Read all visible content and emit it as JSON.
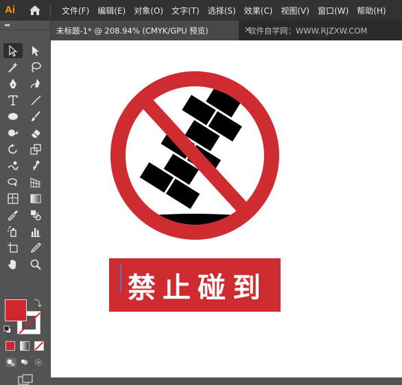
{
  "app": {
    "logo_text": "Ai",
    "brand_color": "#FF9A00"
  },
  "menubar": {
    "items": [
      {
        "label": "文件(F)"
      },
      {
        "label": "编辑(E)"
      },
      {
        "label": "对象(O)"
      },
      {
        "label": "文字(T)"
      },
      {
        "label": "选择(S)"
      },
      {
        "label": "效果(C)"
      },
      {
        "label": "视图(V)"
      },
      {
        "label": "窗口(W)"
      },
      {
        "label": "帮助(H)"
      }
    ]
  },
  "tabs": {
    "document_tab_label": "未标题-1* @ 208.94% (CMYK/GPU 预览)",
    "close_symbol": "×",
    "watermark": "软件自学网：WWW.RJZXW.COM"
  },
  "toolbar": {
    "collapse_symbol": "◂◂",
    "tools": [
      "selection-tool",
      "direct-selection-tool",
      "magic-wand-tool",
      "lasso-tool",
      "pen-tool",
      "curvature-tool",
      "type-tool",
      "line-segment-tool",
      "ellipse-tool",
      "paintbrush-tool",
      "shaper-tool",
      "eraser-tool",
      "rotate-tool",
      "scale-tool",
      "warp-tool",
      "puppet-warp-tool",
      "shape-builder-tool",
      "perspective-grid-tool",
      "mesh-tool",
      "gradient-tool",
      "eyedropper-tool",
      "blend-tool",
      "symbol-sprayer-tool",
      "column-graph-tool",
      "artboard-tool",
      "slice-tool",
      "hand-tool",
      "zoom-tool"
    ],
    "active_tool": "selection-tool",
    "fill_color": "#D1262E",
    "stroke_color": "#FFFFFF"
  },
  "canvas": {
    "sign": {
      "ring_color": "#CE2C31",
      "brick_color": "#000000",
      "caption_text": "禁止碰到",
      "caption_bg": "#CE2C31",
      "caption_color": "#FFFFFF"
    }
  }
}
